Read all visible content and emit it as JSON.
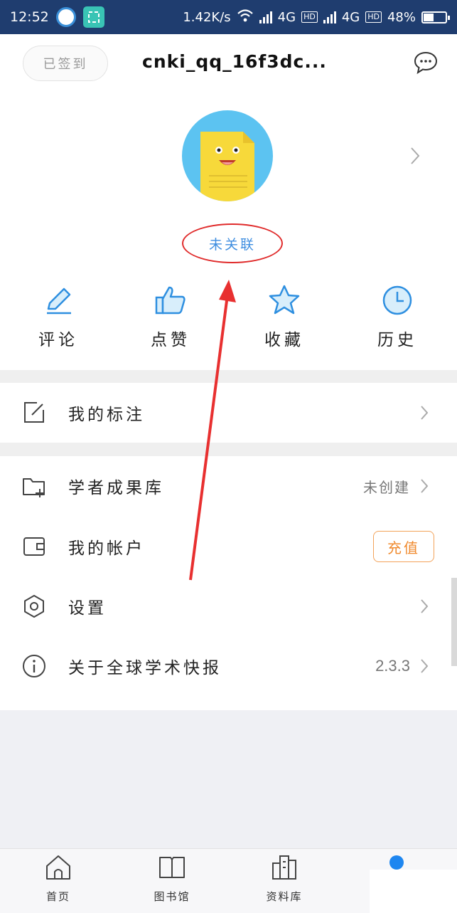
{
  "status_bar": {
    "time": "12:52",
    "speed": "1.42K/s",
    "network1": "4G",
    "network2": "4G",
    "hd": "HD",
    "battery_percent": "48%",
    "battery_level": 0.48
  },
  "header": {
    "checkin_label": "已签到",
    "username": "cnki_qq_16f3dc...",
    "message_icon": "chat-bubble-icon"
  },
  "profile": {
    "avatar_icon": "document-mascot-avatar",
    "bind_status": "未关联"
  },
  "quick_actions": [
    {
      "label": "评论",
      "icon": "pencil-icon"
    },
    {
      "label": "点赞",
      "icon": "thumbs-up-icon"
    },
    {
      "label": "收藏",
      "icon": "star-icon"
    },
    {
      "label": "历史",
      "icon": "clock-icon"
    }
  ],
  "menu": {
    "annotations": {
      "label": "我的标注",
      "icon": "edit-note-icon"
    },
    "scholar_library": {
      "label": "学者成果库",
      "value": "未创建",
      "icon": "folder-add-icon"
    },
    "account": {
      "label": "我的帐户",
      "button": "充值",
      "icon": "wallet-icon"
    },
    "settings": {
      "label": "设置",
      "icon": "hexagon-settings-icon"
    },
    "about": {
      "label": "关于全球学术快报",
      "value": "2.3.3",
      "icon": "info-icon"
    }
  },
  "tabbar": [
    {
      "label": "首页",
      "icon": "home-icon"
    },
    {
      "label": "图书馆",
      "icon": "book-icon"
    },
    {
      "label": "资料库",
      "icon": "buildings-icon"
    },
    {
      "label": "",
      "icon": "user-icon",
      "active": true
    }
  ],
  "colors": {
    "status_bar_bg": "#1f3d6f",
    "accent_blue": "#3f8ee0",
    "annotation_red": "#e02b2b",
    "recharge_orange": "#f08a2e",
    "tab_active": "#1e86f0"
  }
}
